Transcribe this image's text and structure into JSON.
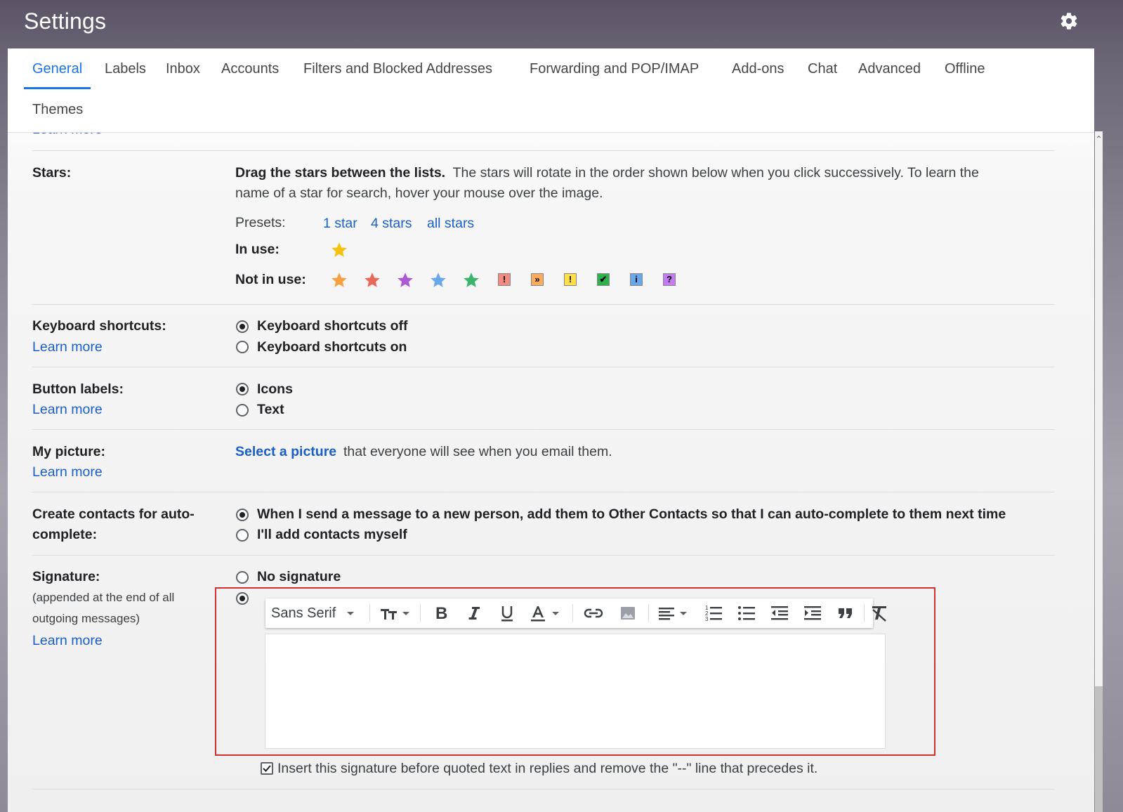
{
  "header": {
    "title": "Settings",
    "settings_icon": "gear-icon"
  },
  "tabs": [
    {
      "label": "General",
      "active": true
    },
    {
      "label": "Labels"
    },
    {
      "label": "Inbox"
    },
    {
      "label": "Accounts"
    },
    {
      "label": "Filters and Blocked Addresses"
    },
    {
      "label": "Forwarding and POP/IMAP"
    },
    {
      "label": "Add-ons"
    },
    {
      "label": "Chat"
    },
    {
      "label": "Advanced"
    },
    {
      "label": "Offline"
    },
    {
      "label": "Themes"
    }
  ],
  "top_clipped_link": "Learn more",
  "stars": {
    "label": "Stars:",
    "description_bold": "Drag the stars between the lists.",
    "description_line1": "The stars will rotate in the order shown below when you click successively. To learn the",
    "description_line2": "name of a star for search, hover your mouse over the image.",
    "presets_label": "Presets:",
    "presets": [
      "1 star",
      "4 stars",
      "all stars"
    ],
    "in_use_label": "In use:",
    "not_in_use_label": "Not in use:",
    "in_use": [
      {
        "icon": "yellow-star-icon",
        "color": "#f4c20d"
      }
    ],
    "not_in_use": [
      {
        "icon": "orange-star-icon",
        "color": "#f5a142"
      },
      {
        "icon": "red-star-icon",
        "color": "#e8685a"
      },
      {
        "icon": "purple-star-icon",
        "color": "#ab5ad2"
      },
      {
        "icon": "blue-star-icon",
        "color": "#6aa6ea"
      },
      {
        "icon": "green-star-icon",
        "color": "#3cb46e"
      },
      {
        "icon": "red-bang-icon",
        "glyph": "!",
        "color": "#f28b82"
      },
      {
        "icon": "orange-guillemet-icon",
        "glyph": "»",
        "color": "#fbab5c"
      },
      {
        "icon": "yellow-bang-icon",
        "glyph": "!",
        "color": "#fde047"
      },
      {
        "icon": "green-check-icon",
        "glyph": "✔",
        "color": "#2bb24c"
      },
      {
        "icon": "blue-info-icon",
        "glyph": "i",
        "color": "#6aa6ea"
      },
      {
        "icon": "purple-question-icon",
        "glyph": "?",
        "color": "#c27bf0"
      }
    ]
  },
  "keyboard": {
    "label": "Keyboard shortcuts:",
    "learn_more": "Learn more",
    "options": [
      "Keyboard shortcuts off",
      "Keyboard shortcuts on"
    ],
    "selected": 0
  },
  "button_labels": {
    "label": "Button labels:",
    "learn_more": "Learn more",
    "options": [
      "Icons",
      "Text"
    ],
    "selected": 0
  },
  "picture": {
    "label": "My picture:",
    "learn_more": "Learn more",
    "link": "Select a picture",
    "text": "that everyone will see when you email them."
  },
  "contacts": {
    "label_line1": "Create contacts for auto-",
    "label_line2": "complete:",
    "options": [
      "When I send a message to a new person, add them to Other Contacts so that I can auto-complete to them next time",
      "I'll add contacts myself"
    ],
    "selected": 0
  },
  "signature": {
    "label": "Signature:",
    "sub_line1": "(appended at the end of all",
    "sub_line2": "outgoing messages)",
    "learn_more": "Learn more",
    "no_signature": "No signature",
    "font": "Sans Serif",
    "editor_value": "",
    "insert_checkbox": "Insert this signature before quoted text in replies and remove the \"--\" line that precedes it.",
    "insert_checked": true
  },
  "colors": {
    "accent": "#1a73e8",
    "link": "#1a5fc8",
    "highlight_border": "#d32f2f"
  }
}
